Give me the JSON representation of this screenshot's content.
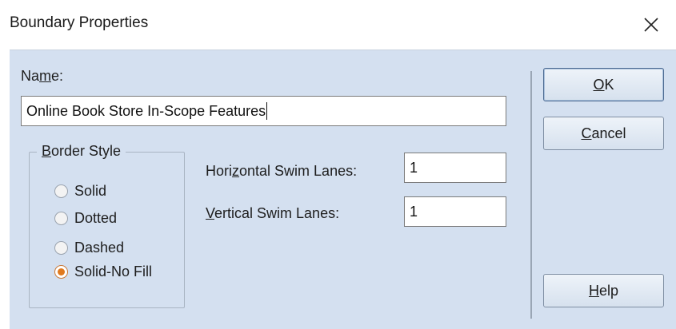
{
  "window": {
    "title": "Boundary Properties"
  },
  "name_field": {
    "label_pre": "Na",
    "label_mnemonic": "m",
    "label_post": "e:",
    "value": "Online Book Store In-Scope Features"
  },
  "border_style": {
    "legend_mnemonic": "B",
    "legend_rest": "order Style",
    "options": [
      {
        "label": "Solid",
        "checked": false
      },
      {
        "label": "Dotted",
        "checked": false
      },
      {
        "label": "Dashed",
        "checked": false
      },
      {
        "label": "Solid-No Fill",
        "checked": true
      }
    ]
  },
  "horizontal_lanes": {
    "label_pre": "Hori",
    "label_mnemonic": "z",
    "label_post": "ontal Swim Lanes:",
    "value": "1"
  },
  "vertical_lanes": {
    "label_mnemonic": "V",
    "label_post": "ertical Swim Lanes:",
    "value": "1"
  },
  "buttons": {
    "ok": {
      "mnemonic": "O",
      "rest": "K"
    },
    "cancel": {
      "mnemonic": "C",
      "rest": "ancel"
    },
    "help": {
      "mnemonic": "H",
      "rest": "elp"
    }
  },
  "colors": {
    "dialog_bg": "#d4e0f0",
    "radio_selected": "#e07a1f"
  }
}
